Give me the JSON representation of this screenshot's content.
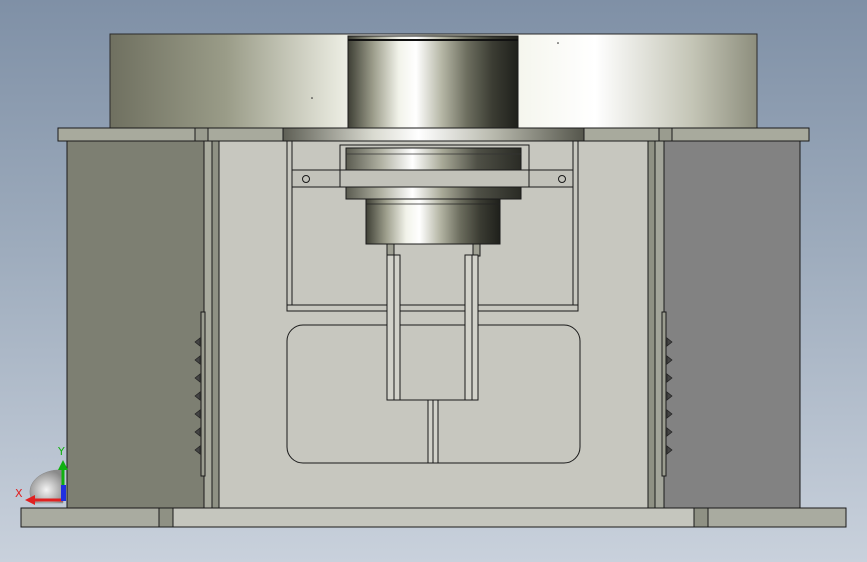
{
  "viewport": {
    "background_top": "#7f90a6",
    "background_bottom": "#c9d1dc"
  },
  "triad": {
    "x_label": "X",
    "y_label": "Y",
    "x_color": "#e02020",
    "y_color": "#10b010",
    "z_color": "#2030e0"
  },
  "colors": {
    "housing_dark": "#7d7f72",
    "housing_right": "#828282",
    "panel_light": "#c7c7bf",
    "base_plate": "#a9aba0",
    "outline": "#1a1a1a"
  }
}
